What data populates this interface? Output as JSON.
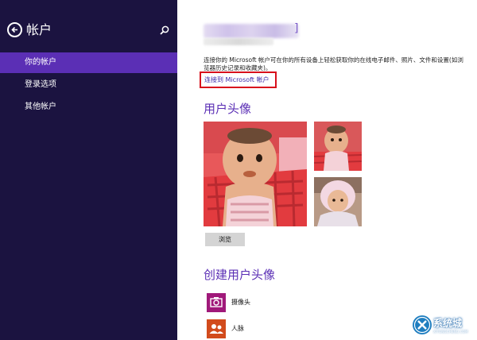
{
  "theme": {
    "sidebar_bg": "#1b1340",
    "sidebar_active": "#5b2fb5",
    "accent": "#5b2fb5",
    "highlight_box": "#d8101c"
  },
  "sidebar": {
    "back_icon": "back-arrow-icon",
    "title": "帐户",
    "search_icon": "search-icon",
    "items": [
      {
        "label": "你的帐户",
        "active": true
      },
      {
        "label": "登录选项",
        "active": false
      },
      {
        "label": "其他帐户",
        "active": false
      }
    ]
  },
  "account": {
    "name_bracket": "]",
    "description": "连接你的 Microsoft 帐户可在你的所有设备上轻松获取你的在线电子邮件、照片、文件和设置(如浏览器历史记录和收藏夹)。",
    "connect_link": "连接到 Microsoft 帐户"
  },
  "user_picture": {
    "title": "用户头像",
    "browse_label": "浏览"
  },
  "create_picture": {
    "title": "创建用户头像",
    "items": [
      {
        "label": "摄像头",
        "icon": "camera-icon",
        "color": "#a0197a"
      },
      {
        "label": "人脉",
        "icon": "people-icon",
        "color": "#d24b1c"
      }
    ]
  },
  "watermark": {
    "text": "系统城",
    "subtext": "XITONGCHENG.COM",
    "icon": "x-logo-icon"
  }
}
